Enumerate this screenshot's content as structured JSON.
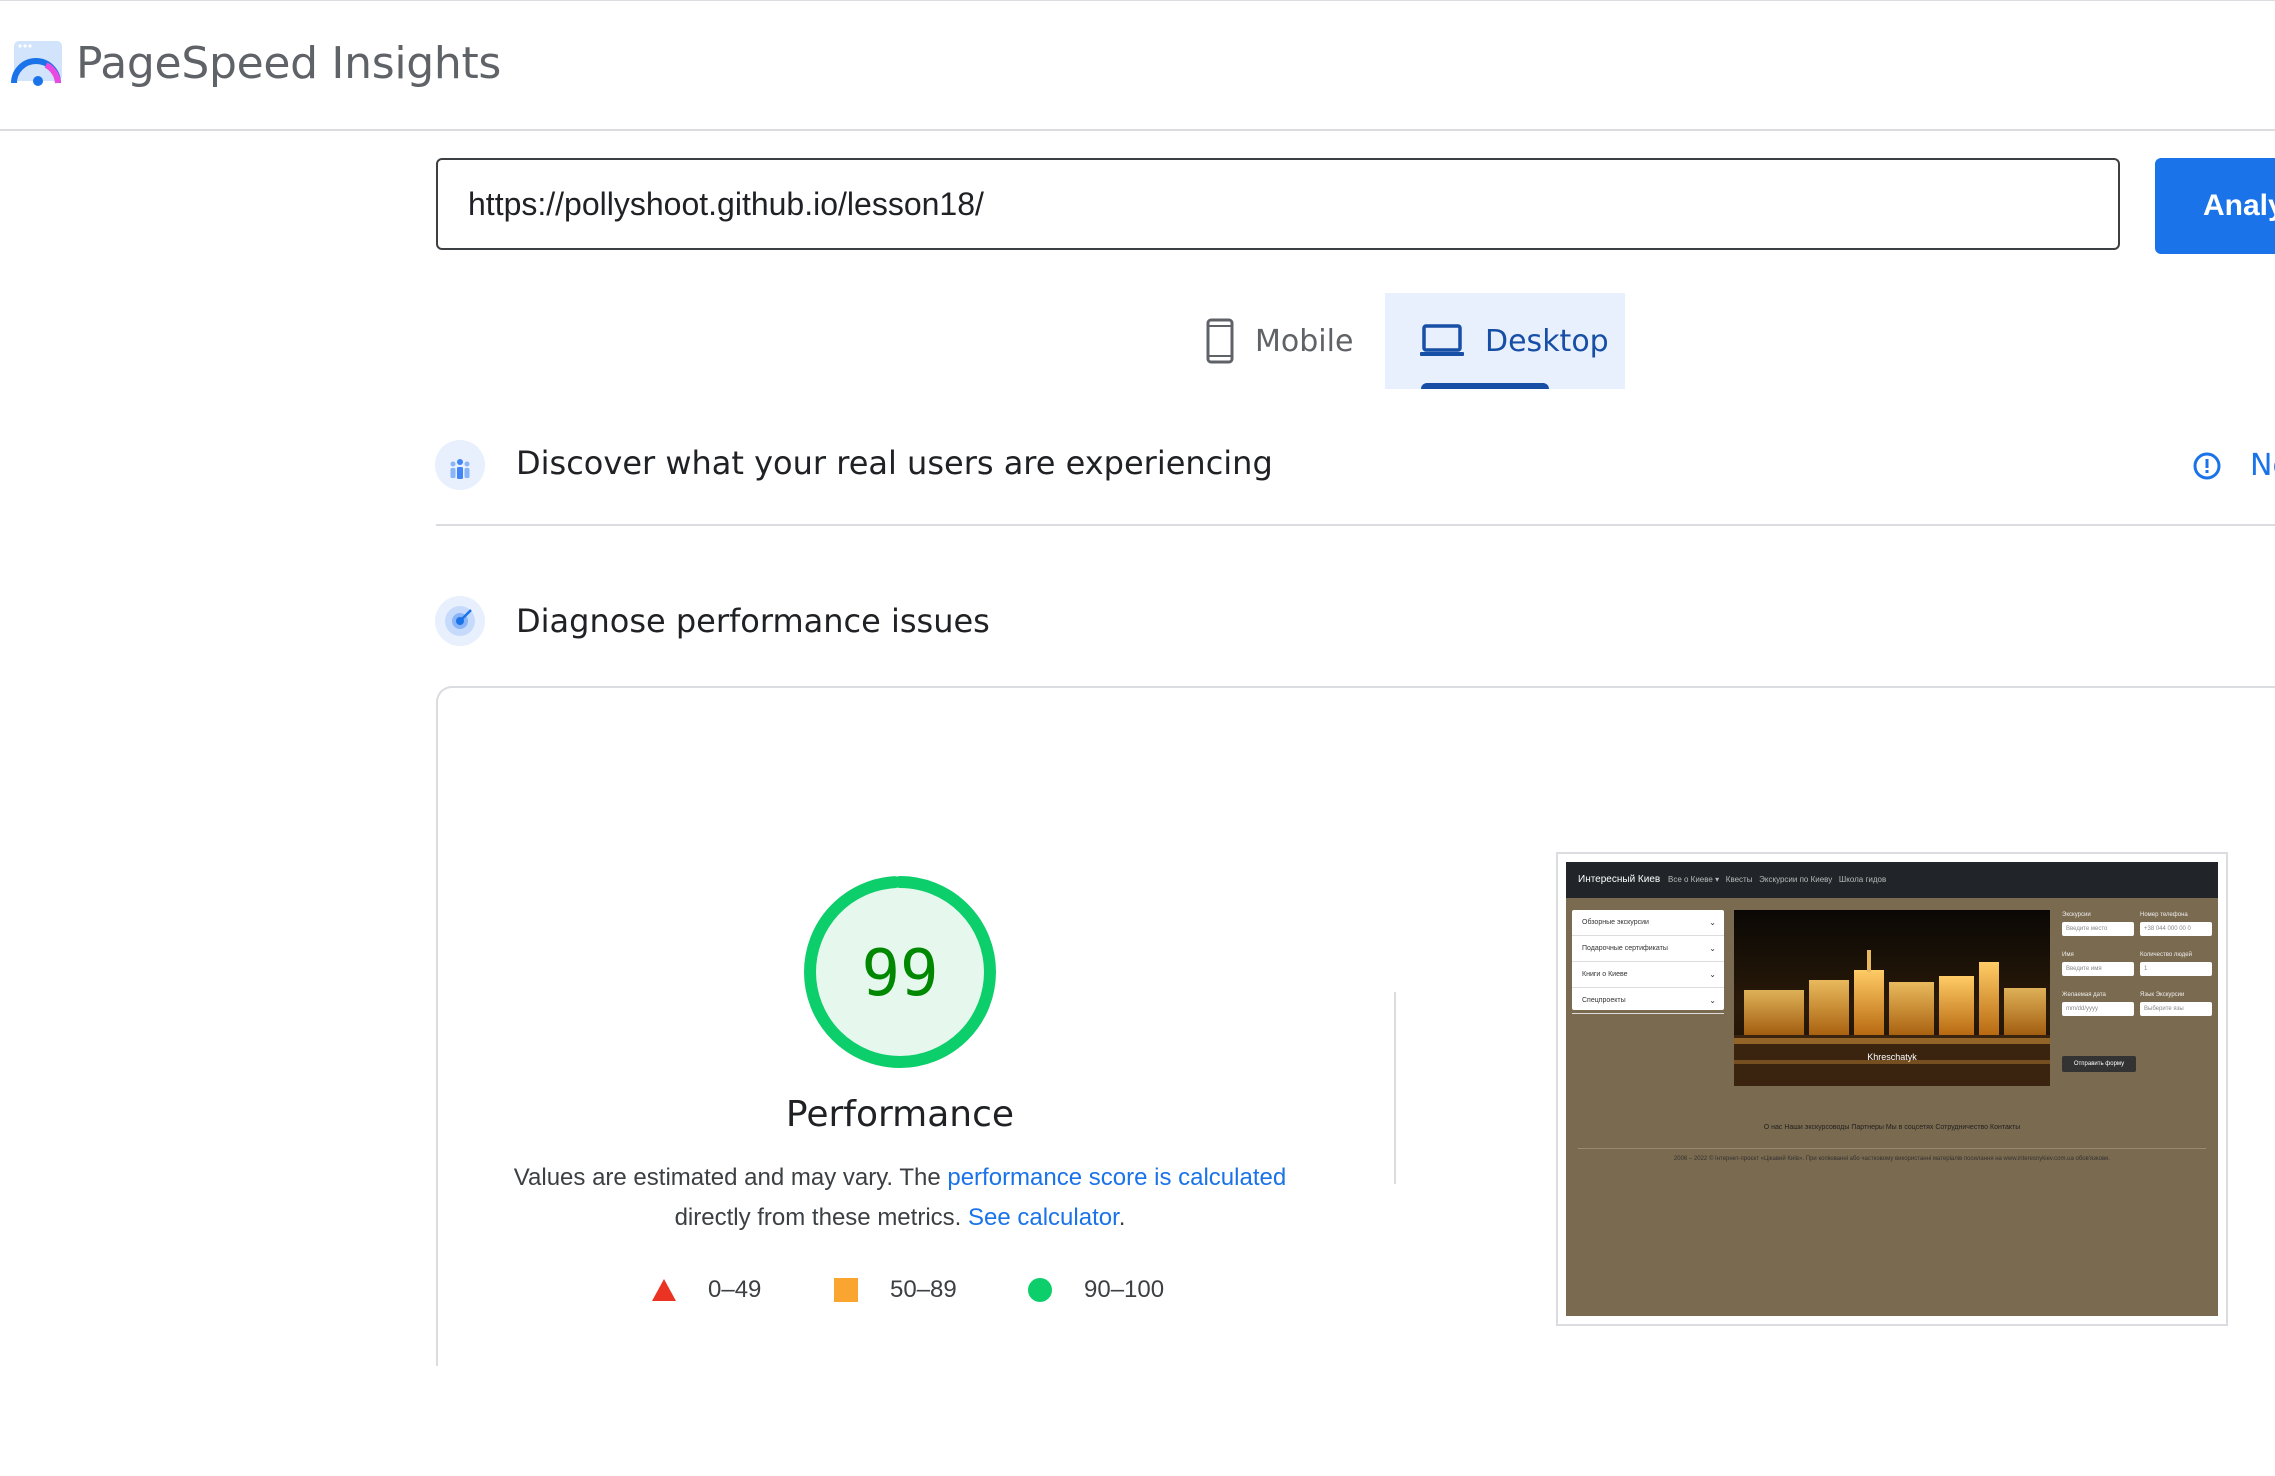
{
  "app": {
    "title": "PageSpeed Insights"
  },
  "search": {
    "url": "https://pollyshoot.github.io/lesson18/",
    "analyze_label": "Analy"
  },
  "tabs": [
    {
      "label": "Mobile",
      "icon": "smartphone-icon",
      "active": false
    },
    {
      "label": "Desktop",
      "icon": "laptop-icon",
      "active": true
    }
  ],
  "sections": {
    "field_data": {
      "title": "Discover what your real users are experiencing",
      "status_text": "No"
    },
    "lab_data": {
      "title": "Diagnose performance issues"
    }
  },
  "performance": {
    "score": "99",
    "score_value": 99,
    "label": "Performance",
    "desc_prefix": "Values are estimated and may vary. The",
    "desc_link": "performance score is calculated",
    "desc_middle": "directly from these metrics.",
    "desc_link2": "See calculator",
    "desc_suffix": "."
  },
  "legend": [
    {
      "range": "0–49",
      "shape": "triangle",
      "color": "#eb3324"
    },
    {
      "range": "50–89",
      "shape": "square",
      "color": "#fba531"
    },
    {
      "range": "90–100",
      "shape": "circle",
      "color": "#0cce6b"
    }
  ],
  "colors": {
    "accent": "#1a73e8",
    "pass_ring": "#0cce6b",
    "pass_fill": "#e6f7ee",
    "pass_text": "#008800"
  },
  "screenshot": {
    "brand": "Интересный Киев",
    "nav_links": [
      "Все о Киеве ▾",
      "Квесты",
      "Экскурсии по Киеву",
      "Школа гидов"
    ],
    "accordion": [
      "Обзорные экскурсии",
      "Подарочные сертификаты",
      "Книги о Киеве",
      "Спецпроекты"
    ],
    "photo_caption": "Khreschatyk",
    "form": {
      "labels": [
        "Экскурсии",
        "Номер телефона",
        "Имя",
        "Количество людей",
        "Желаемая дата",
        "Язык Экскурсии"
      ],
      "inputs": [
        "Введите место",
        "+38 044 000 00 0",
        "Введите имя",
        "1",
        "mm/dd/yyyy",
        "Выберите язы"
      ],
      "submit": "Отправить форму"
    },
    "footer_links": "О нас   Наши экскурсоводы   Партнеры   Мы в соцсетях   Сотрудничество   Контакты",
    "copyright": "2006 – 2022 © Інтернет-проєкт «Цікавий Київ». При копіюванні або частковому використанні матеріалів посилання на www.interesnykiev.com.ua обов'язкове."
  }
}
